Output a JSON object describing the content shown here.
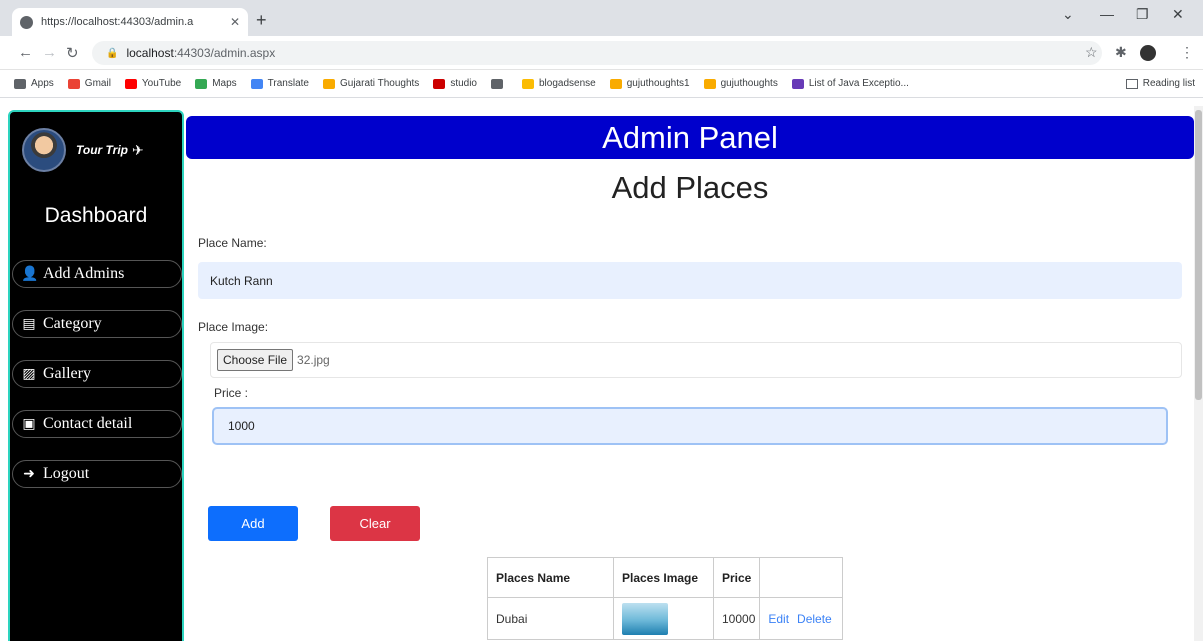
{
  "browser": {
    "tab_title": "https://localhost:44303/admin.a",
    "new_tab": "+",
    "url_host": "localhost",
    "url_path": ":44303/admin.aspx",
    "bookmarks": [
      {
        "label": "Apps",
        "color": "#5f6368"
      },
      {
        "label": "Gmail",
        "color": "#ea4335"
      },
      {
        "label": "YouTube",
        "color": "#ff0000"
      },
      {
        "label": "Maps",
        "color": "#34a853"
      },
      {
        "label": "Translate",
        "color": "#4285f4"
      },
      {
        "label": "Gujarati Thoughts",
        "color": "#f9ab00"
      },
      {
        "label": "studio",
        "color": "#cc0000"
      },
      {
        "label": "",
        "color": "#5f6368"
      },
      {
        "label": "blogadsense",
        "color": "#fbbc04"
      },
      {
        "label": "gujuthoughts1",
        "color": "#f9ab00"
      },
      {
        "label": "gujuthoughts",
        "color": "#f9ab00"
      },
      {
        "label": "List of Java Exceptio...",
        "color": "#673ab7"
      }
    ],
    "reading_list": "Reading list"
  },
  "sidebar": {
    "brand": "Tour Trip",
    "dashboard": "Dashboard",
    "items": [
      {
        "label": "Add Admins",
        "icon": "user-icon"
      },
      {
        "label": "Category",
        "icon": "list-icon"
      },
      {
        "label": "Gallery",
        "icon": "image-icon"
      },
      {
        "label": "Contact detail",
        "icon": "contact-icon"
      },
      {
        "label": "Logout",
        "icon": "logout-icon"
      }
    ]
  },
  "header": {
    "title": "Admin Panel"
  },
  "form": {
    "page_title": "Add Places",
    "place_name_label": "Place Name:",
    "place_name_value": "Kutch Rann",
    "place_image_label": "Place Image:",
    "choose_file": "Choose File",
    "file_name": "32.jpg",
    "price_label": "Price :",
    "price_value": "1000",
    "add_label": "Add",
    "clear_label": "Clear"
  },
  "table": {
    "headers": [
      "Places Name",
      "Places Image",
      "Price",
      ""
    ],
    "rows": [
      {
        "name": "Dubai",
        "price": "10000",
        "edit": "Edit",
        "delete": "Delete"
      }
    ]
  }
}
